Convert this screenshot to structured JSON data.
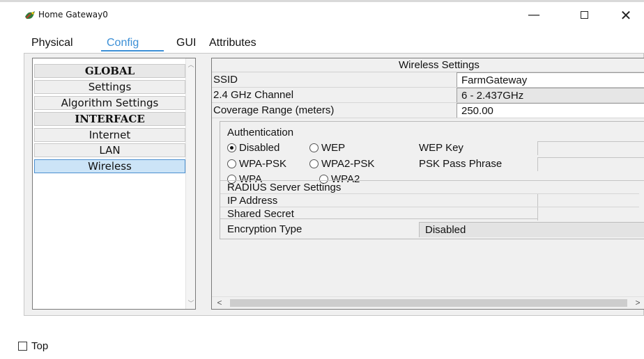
{
  "window": {
    "title": "Home Gateway0",
    "icon": "router-icon",
    "minimize": "—",
    "close": "✕"
  },
  "tabs": [
    {
      "label": "Physical"
    },
    {
      "label": "Config",
      "active": true
    },
    {
      "label": "GUI"
    },
    {
      "label": "Attributes"
    }
  ],
  "sidebar": {
    "items": [
      {
        "label": "GLOBAL",
        "type": "header"
      },
      {
        "label": "Settings"
      },
      {
        "label": "Algorithm Settings"
      },
      {
        "label": "INTERFACE",
        "type": "header"
      },
      {
        "label": "Internet"
      },
      {
        "label": "LAN"
      },
      {
        "label": "Wireless",
        "selected": true
      }
    ]
  },
  "wireless": {
    "header": "Wireless Settings",
    "ssid_label": "SSID",
    "ssid_value": "FarmGateway",
    "channel_label": "2.4 GHz Channel",
    "channel_value": "6 - 2.437GHz",
    "coverage_label": "Coverage Range (meters)",
    "coverage_value": "250.00",
    "auth": {
      "title": "Authentication",
      "options": {
        "disabled": "Disabled",
        "wep": "WEP",
        "wpa_psk": "WPA-PSK",
        "wpa2_psk": "WPA2-PSK",
        "wpa": "WPA",
        "wpa2": "WPA2"
      },
      "selected": "Disabled",
      "wep_key_label": "WEP Key",
      "psk_label": "PSK Pass Phrase",
      "wep_key_value": "",
      "psk_value": ""
    },
    "radius": {
      "title": "RADIUS Server Settings",
      "ip_label": "IP Address",
      "secret_label": "Shared Secret",
      "ip_value": "",
      "secret_value": ""
    },
    "encryption": {
      "label": "Encryption Type",
      "value": "Disabled"
    }
  },
  "footer": {
    "top_label": "Top",
    "top_checked": false
  }
}
